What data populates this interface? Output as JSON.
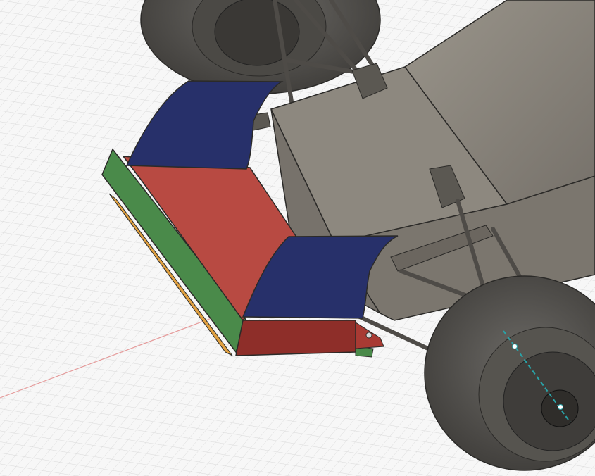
{
  "app": {
    "name": "CAD 3D Viewport"
  },
  "viewport": {
    "background": "#f7f7f7",
    "grid_color": "#d7d7d7",
    "grid_major_color": "#c4c4c4",
    "x_axis_color": "#e79a9a",
    "model_colors": {
      "chassis": "#8a857c",
      "chassis_dark": "#6f6a62",
      "tire": "#5e5c58",
      "tire_dark": "#3f3d3a",
      "rim": "#4a4844",
      "wing_blue": "#27306a",
      "wing_red": "#b84a42",
      "wing_red_dark": "#8e2e29",
      "endplate_green": "#4a8a4a",
      "endplate_orange": "#e0a040",
      "steering_axis": "#2aa3a8"
    },
    "icons": [
      "steering-axis-handle-icon"
    ]
  }
}
